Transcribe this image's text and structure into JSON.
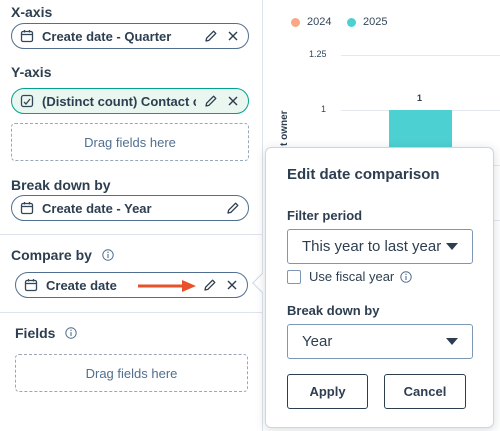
{
  "left_panel": {
    "x_axis": {
      "title": "X-axis",
      "field": "Create date - Quarter"
    },
    "y_axis": {
      "title": "Y-axis",
      "field": "(Distinct count) Contact ow",
      "dropzone": "Drag fields here"
    },
    "break_down": {
      "title": "Break down by",
      "field": "Create date - Year"
    },
    "compare": {
      "title": "Compare by",
      "field": "Create date"
    },
    "fields": {
      "title": "Fields",
      "dropzone": "Drag fields here"
    }
  },
  "chart_preview": {
    "legend": [
      {
        "label": "2024",
        "color": "#f8a885"
      },
      {
        "label": "2025",
        "color": "#4dd0d1"
      }
    ],
    "y_ticks": [
      "1.25",
      "1"
    ],
    "bar_value_label": "1",
    "y_axis_title_fragment": "t owner"
  },
  "popover": {
    "title": "Edit date comparison",
    "filter_label": "Filter period",
    "filter_value": "This year to last year",
    "fiscal_label": "Use fiscal year",
    "breakdown_label": "Break down by",
    "breakdown_value": "Year",
    "apply": "Apply",
    "cancel": "Cancel"
  },
  "colors": {
    "accent_teal": "#4dd0d1",
    "accent_orange": "#f8a885",
    "annotation_arrow": "#e8522a",
    "y_pill_bg": "#eaf7f0",
    "y_pill_border": "#00a38d"
  }
}
